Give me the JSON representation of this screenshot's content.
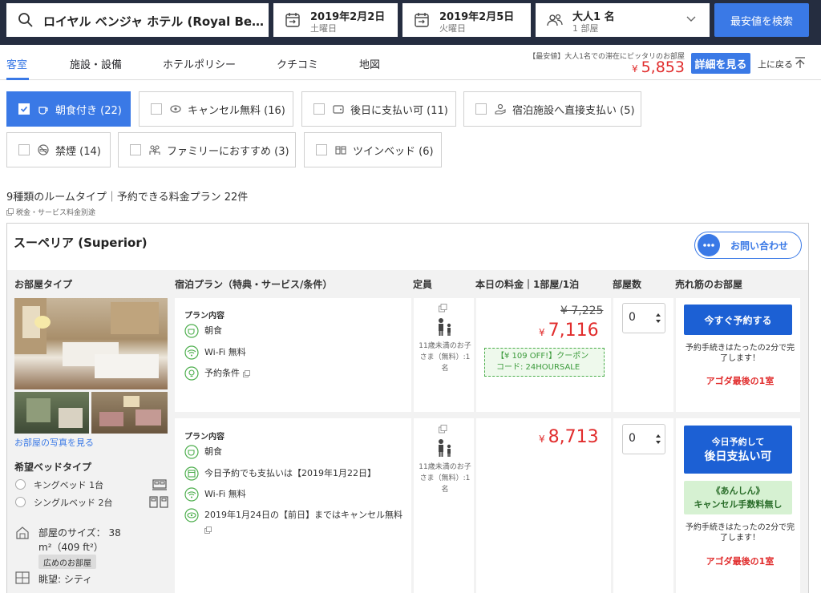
{
  "search": {
    "hotel_name": "ロイヤル ベンジャ ホテル (Royal Be…",
    "checkin_date": "2019年2月2日",
    "checkin_day": "土曜日",
    "checkout_date": "2019年2月5日",
    "checkout_day": "火曜日",
    "guests": "大人1 名",
    "rooms": "1 部屋",
    "search_button": "最安値を検索"
  },
  "tabs": [
    "客室",
    "施設・設備",
    "ホテルポリシー",
    "クチコミ",
    "地図"
  ],
  "lowest": {
    "note": "【最安値】大人1名での滞在にピッタリのお部屋",
    "currency": "¥",
    "price": "5,853",
    "details_button": "詳細を見る",
    "back_to_top": "上に戻る"
  },
  "filters": [
    {
      "label": "朝食付き (22)",
      "checked": true,
      "icon": "breakfast-icon"
    },
    {
      "label": "キャンセル無料 (16)",
      "checked": false,
      "icon": "cancel-free-icon"
    },
    {
      "label": "後日に支払い可 (11)",
      "checked": false,
      "icon": "wallet-icon"
    },
    {
      "label": "宿泊施設へ直接支払い (5)",
      "checked": false,
      "icon": "hand-coin-icon"
    },
    {
      "label": "禁煙 (14)",
      "checked": false,
      "icon": "no-smoking-icon"
    },
    {
      "label": "ファミリーにおすすめ (3)",
      "checked": false,
      "icon": "family-icon"
    },
    {
      "label": "ツインベッド (6)",
      "checked": false,
      "icon": "twin-bed-icon"
    }
  ],
  "summary": {
    "room_count": "9種類のルームタイプ｜予約できる料金プラン 22件",
    "tax_note": "税金・サービス料金別途"
  },
  "room": {
    "title": "スーペリア (Superior)",
    "contact_button": "お問い合わせ",
    "columns": [
      "お部屋タイプ",
      "宿泊プラン（特典・サービス/条件）",
      "定員",
      "本日の料金｜1部屋/1泊",
      "部屋数",
      "売れ筋のお部屋"
    ],
    "photo_link": "お部屋の写真を見る",
    "bed_type_title": "希望ベッドタイプ",
    "bed_options": [
      "キングベッド 1台",
      "シングルベッド 2台"
    ],
    "size_label": "部屋のサイズ： 38 m²（409 ft²）",
    "wide_badge": "広めのお部屋",
    "view": "眺望: シティ"
  },
  "plans": [
    {
      "heading": "プラン内容",
      "features": [
        "朝食",
        "Wi-Fi 無料",
        "予約条件"
      ],
      "occupancy_note": "11歳未満のお子さま（無料）:1名",
      "original_price": "¥ 7,225",
      "currency": "¥",
      "price": "7,116",
      "coupon_line1": "【¥ 109 OFF!】クーポン",
      "coupon_line2": "コード: 24HOURSALE",
      "rooms_selected": "0",
      "book_button": "今すぐ予約する",
      "proc_note": "予約手続きはたったの2分で完了します！",
      "last_room": "アゴダ最後の1室"
    },
    {
      "heading": "プラン内容",
      "features": [
        "朝食",
        "今日予約でも支払いは【2019年1月22日】",
        "Wi-Fi 無料",
        "2019年1月24日の【前日】まではキャンセル無料"
      ],
      "occupancy_note": "11歳未満のお子さま（無料）:1名",
      "currency": "¥",
      "price": "8,713",
      "rooms_selected": "0",
      "book_line1": "今日予約して",
      "book_line2": "後日支払い可",
      "relief_line1": "《あんしん》",
      "relief_line2": "キャンセル手数料無し",
      "proc_note": "予約手続きはたったの2分で完了します！",
      "last_room": "アゴダ最後の1室"
    }
  ],
  "colors": {
    "accent": "#3a79e6",
    "price_red": "#e12d2d",
    "topbar": "#252d40",
    "green": "#4cae4c"
  }
}
